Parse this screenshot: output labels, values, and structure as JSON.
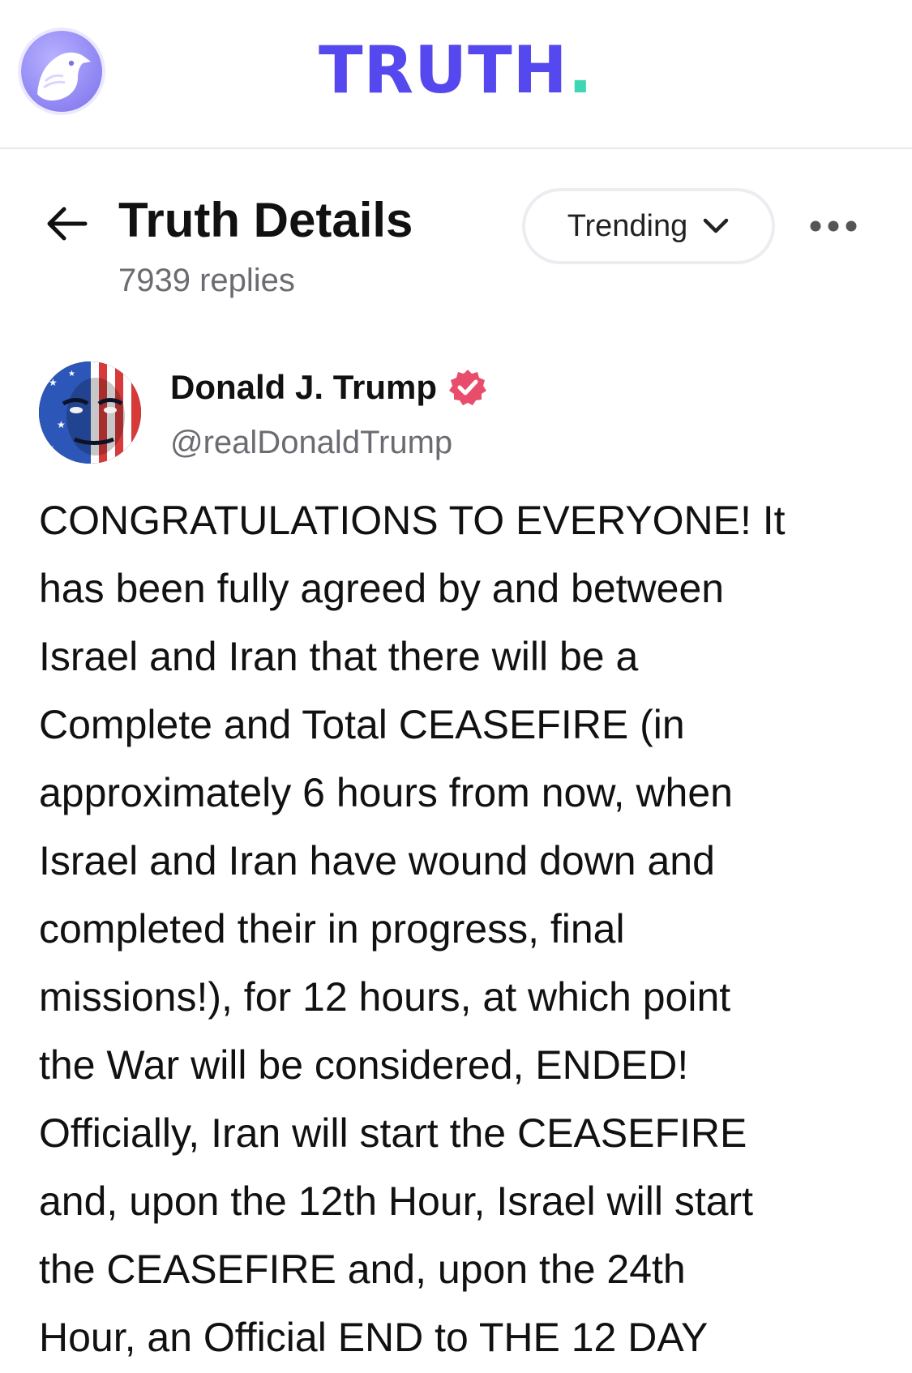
{
  "header": {
    "brand_name": "TRUTH",
    "brand_dot": ".",
    "accent_color": "#5448ee",
    "dot_color": "#3fd6b3",
    "logo_icon": "eagle-logo-icon"
  },
  "details": {
    "title": "Truth Details",
    "reply_count": "7939 replies",
    "sort_label": "Trending",
    "back_icon": "arrow-left-icon",
    "sort_icon": "chevron-down-icon",
    "more_icon": "more-horizontal-icon"
  },
  "post": {
    "author_name": "Donald J. Trump",
    "author_handle": "@realDonaldTrump",
    "verified": true,
    "verified_color": "#e84d6b",
    "body": "CONGRATULATIONS TO EVERYONE! It\nhas been fully agreed by and between\nIsrael and Iran that there will be a\nComplete and Total CEASEFIRE (in\napproximately 6 hours from now, when\nIsrael and Iran have wound down and\ncompleted their in progress, final\nmissions!), for 12 hours, at which point\nthe War will be considered, ENDED!\nOfficially, Iran will start the CEASEFIRE\nand, upon the 12th Hour, Israel will start\nthe CEASEFIRE and, upon the 24th\nHour, an Official END to THE 12 DAY"
  }
}
